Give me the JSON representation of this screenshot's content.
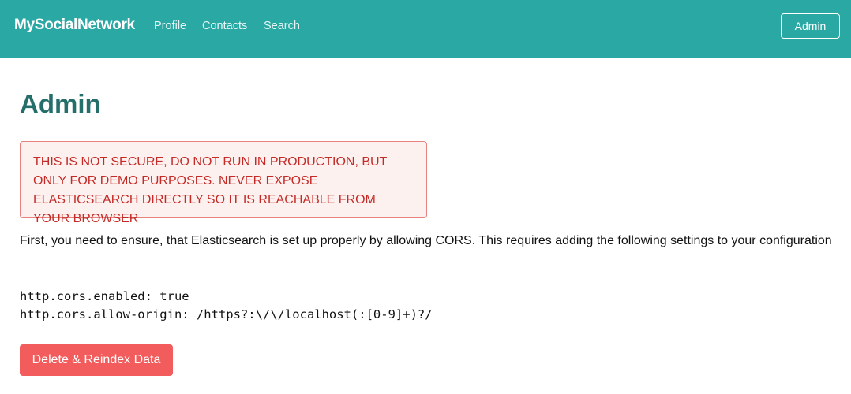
{
  "navbar": {
    "brand": "MySocialNetwork",
    "links": [
      "Profile",
      "Contacts",
      "Search"
    ],
    "admin_button": "Admin",
    "background_color": "#2aa8a4"
  },
  "main": {
    "title": "Admin",
    "alert_text": "THIS IS NOT SECURE, DO NOT RUN IN PRODUCTION, BUT ONLY FOR DEMO PURPOSES. NEVER EXPOSE ELASTICSEARCH DIRECTLY SO IT IS REACHABLE FROM YOUR BROWSER",
    "intro_text": "First, you need to ensure, that Elasticsearch is set up properly by allowing CORS. This requires adding the following settings to your configuration",
    "code_lines": [
      "http.cors.enabled: true",
      "http.cors.allow-origin: /https?:\\/\\/localhost(:[0-9]+)?/"
    ],
    "action_button": "Delete & Reindex Data",
    "action_button_color": "#f25c5c",
    "alert_color": "#c42b27"
  }
}
